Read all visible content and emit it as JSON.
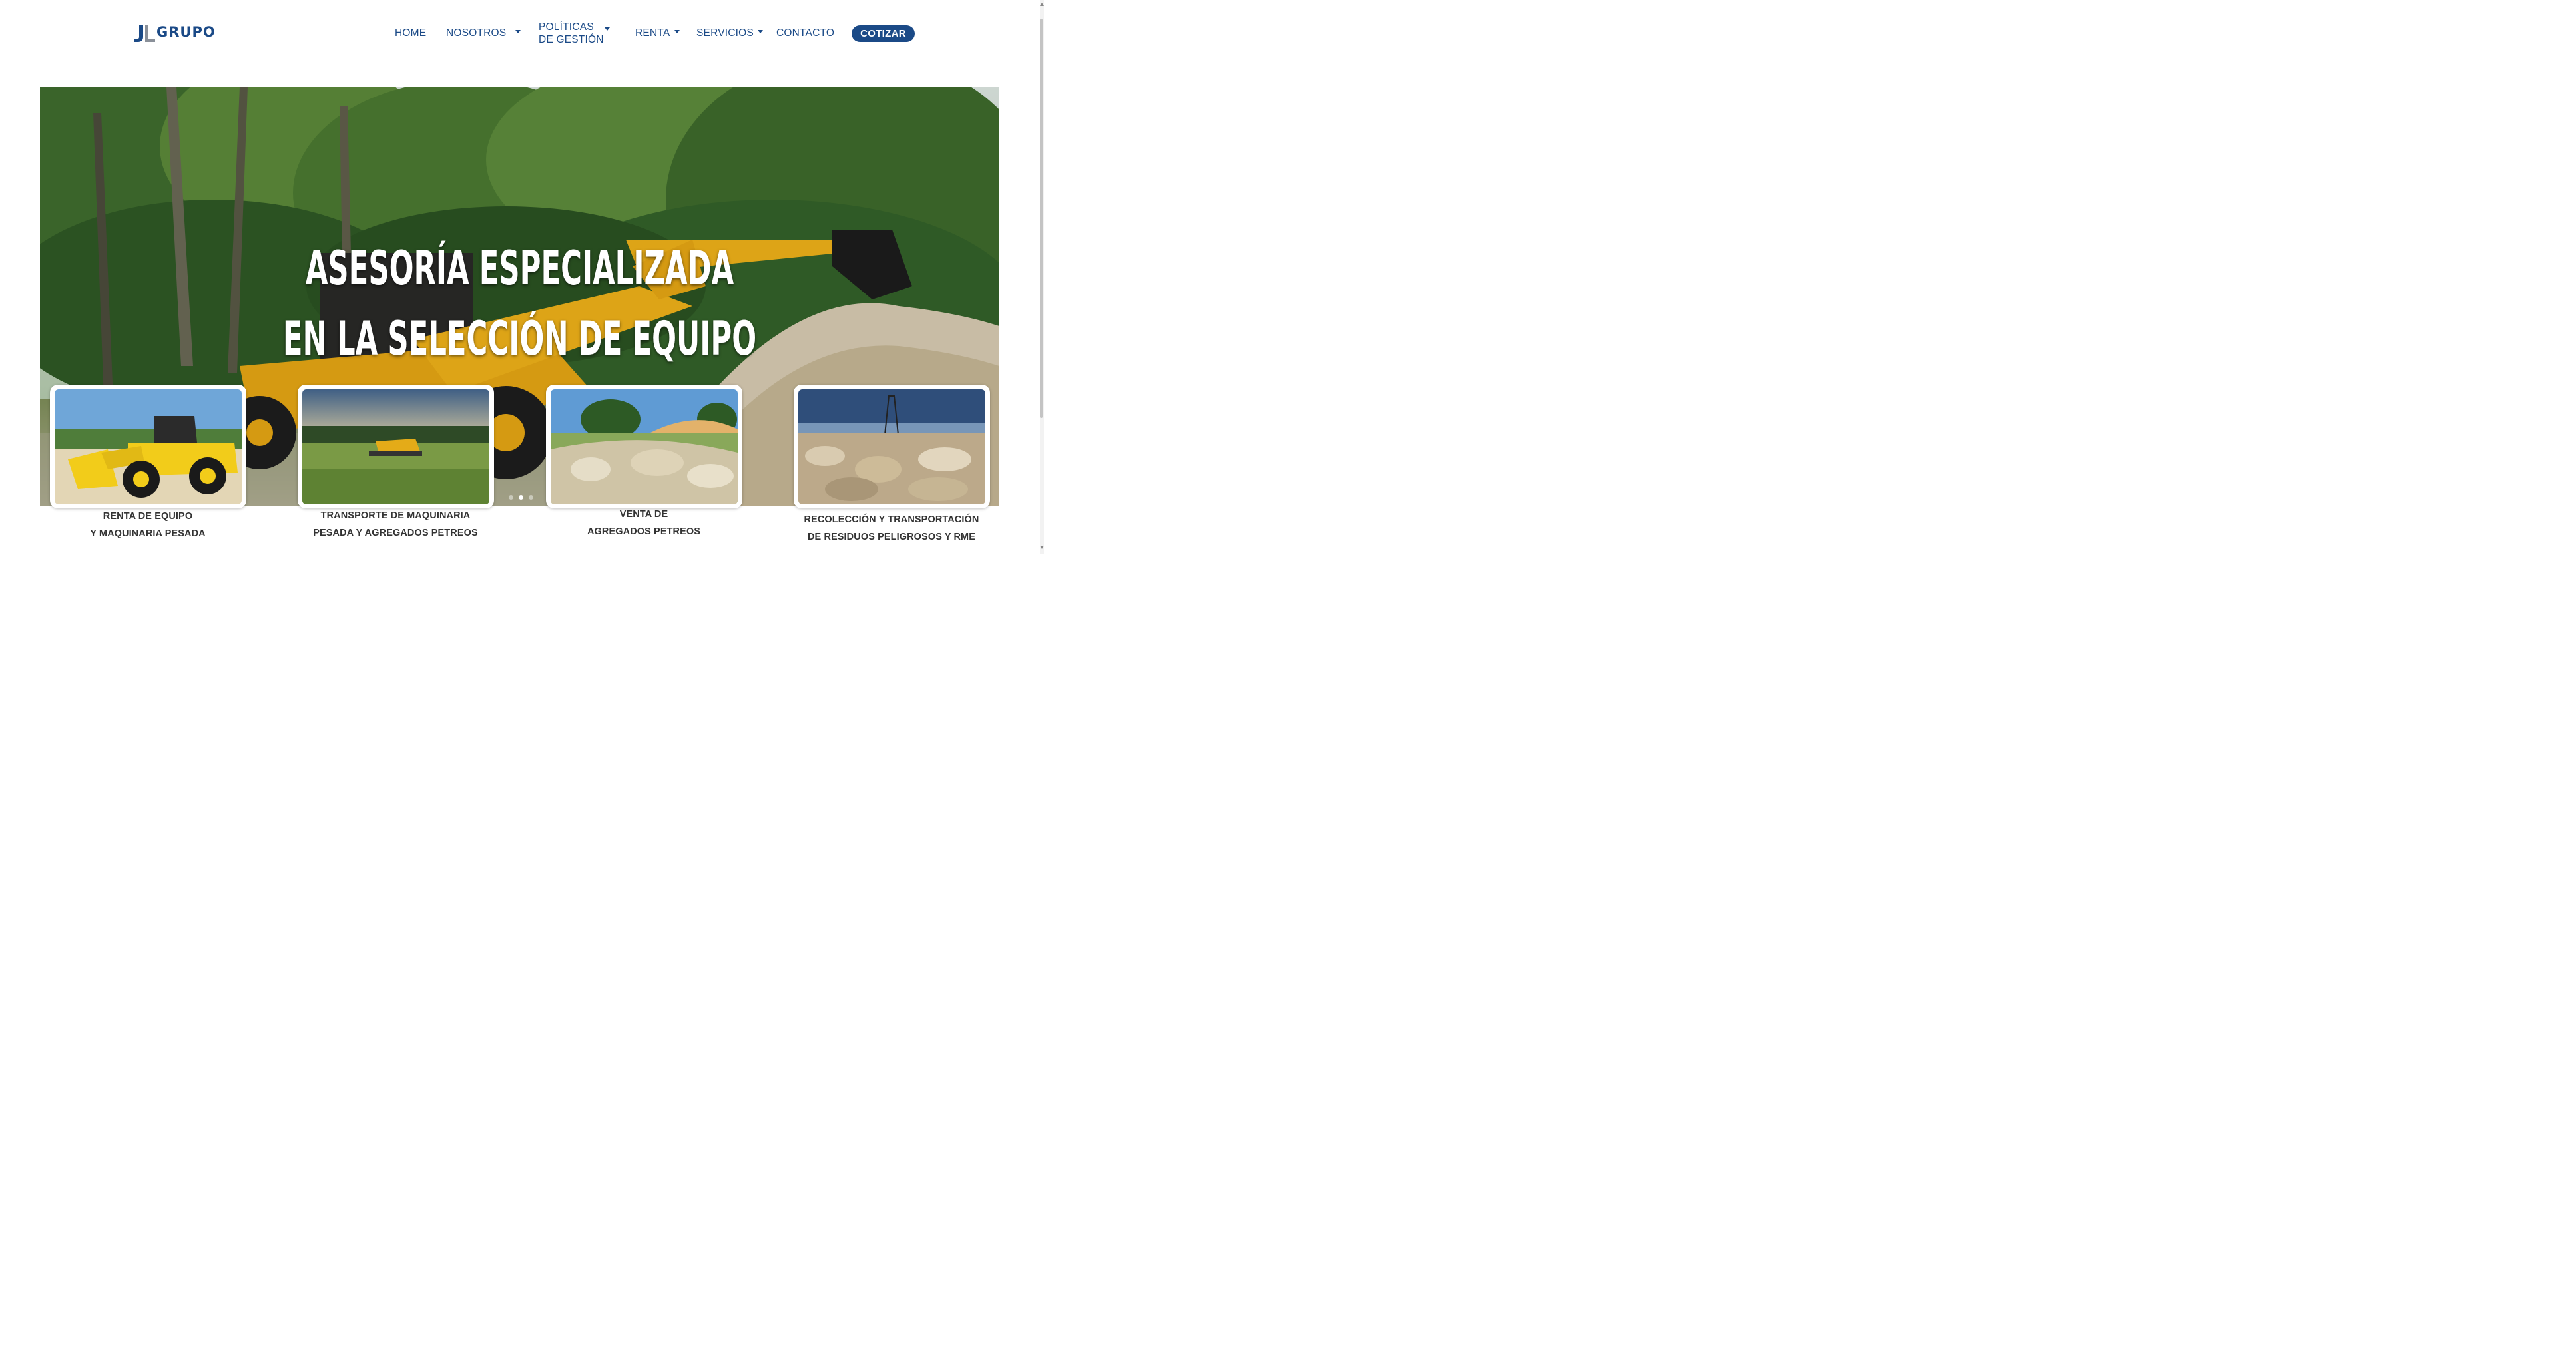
{
  "brand": {
    "logo_text": "GRUPO",
    "logo_mark": "JL",
    "color": "#1b4a87"
  },
  "nav": {
    "items": [
      {
        "label": "HOME",
        "dropdown": false
      },
      {
        "label": "NOSOTROS",
        "dropdown": true
      },
      {
        "label_line1": "POLÍTICAS",
        "label_line2": "DE GESTIÓN",
        "dropdown": true
      },
      {
        "label": "RENTA",
        "dropdown": true
      },
      {
        "label": "SERVICIOS",
        "dropdown": true
      },
      {
        "label": "CONTACTO",
        "dropdown": false
      }
    ],
    "cta_label": "COTIZAR"
  },
  "hero": {
    "title_line1": "ASESORÍA ESPECIALIZADA",
    "title_line2": "EN LA SELECCIÓN DE EQUIPO",
    "slide_count": 3,
    "active_slide": 2
  },
  "services": [
    {
      "line1": "RENTA DE EQUIPO",
      "line2": "Y MAQUINARIA PESADA",
      "image": "wheel-loader-photo"
    },
    {
      "line1": "TRANSPORTE DE MAQUINARIA",
      "line2": "PESADA Y AGREGADOS PETREOS",
      "image": "field-bulldozer-photo"
    },
    {
      "line1": "VENTA DE",
      "line2": "AGREGADOS PETREOS",
      "image": "rock-pile-photo"
    },
    {
      "line1": "RECOLECCIÓN Y TRANSPORTACIÓN",
      "line2": "DE RESIDUOS PELIGROSOS Y RME",
      "image": "drilling-rig-rocks-photo"
    }
  ],
  "colors": {
    "accent": "#1b4a87",
    "machine_yellow": "#f0b21a",
    "text_dark": "#333333"
  }
}
